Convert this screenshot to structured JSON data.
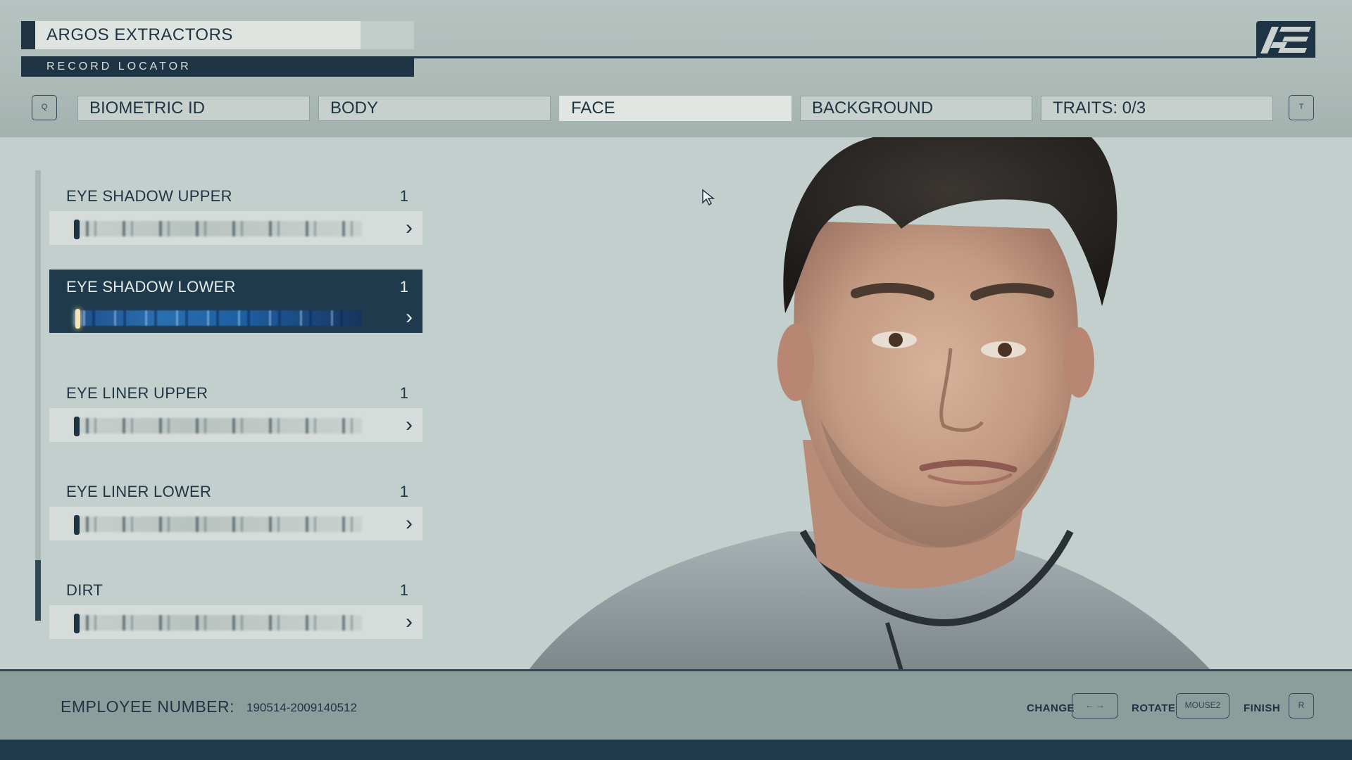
{
  "header": {
    "company": "ARGOS EXTRACTORS",
    "section": "RECORD LOCATOR",
    "logo_icon": "ae-logo-icon",
    "prev_key": "Q",
    "next_key": "T"
  },
  "tabs": [
    {
      "label": "BIOMETRIC ID",
      "active": false
    },
    {
      "label": "BODY",
      "active": false
    },
    {
      "label": "FACE",
      "active": true
    },
    {
      "label": "BACKGROUND",
      "active": false
    },
    {
      "label": "TRAITS: 0/3",
      "active": false
    }
  ],
  "options": [
    {
      "label": "EYE SHADOW UPPER",
      "value": "1",
      "selected": false
    },
    {
      "label": "EYE SHADOW LOWER",
      "value": "1",
      "selected": true
    },
    {
      "label": "EYE LINER UPPER",
      "value": "1",
      "selected": false
    },
    {
      "label": "EYE LINER LOWER",
      "value": "1",
      "selected": false
    },
    {
      "label": "DIRT",
      "value": "1",
      "selected": false
    }
  ],
  "footer": {
    "employee_label": "EMPLOYEE NUMBER:",
    "employee_number": "190514-2009140512",
    "change_label": "CHANGE",
    "change_key": "← →",
    "rotate_label": "ROTATE",
    "rotate_key": "MOUSE2",
    "finish_label": "FINISH",
    "finish_key": "R"
  },
  "colors": {
    "accent_dark": "#1e3444",
    "panel_bg": "#c3cfcc",
    "selected_bg": "#1f3a4c",
    "footer_bg": "#8c9e9b"
  }
}
